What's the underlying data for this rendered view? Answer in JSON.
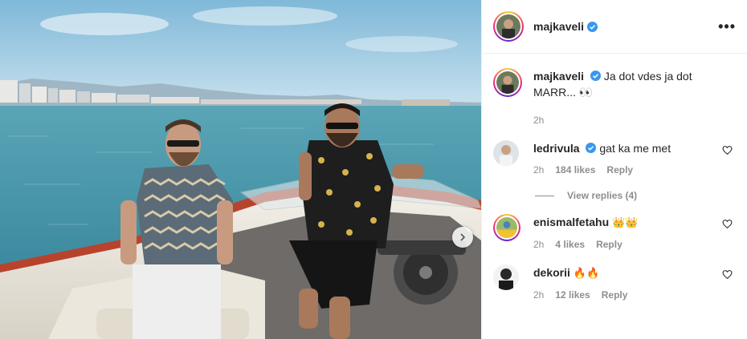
{
  "post": {
    "username": "majkaveli",
    "verified": true,
    "more_icon": "•••"
  },
  "caption": {
    "username": "majkaveli",
    "text": "Ja dot vdes ja dot MARR... 👀",
    "time": "2h"
  },
  "comments": [
    {
      "username": "ledrivula",
      "verified": true,
      "text": "gat ka me met",
      "time": "2h",
      "likes": "184 likes",
      "reply": "Reply",
      "view_replies": "View replies (4)"
    },
    {
      "username": "enismalfetahu",
      "verified": false,
      "text": "👑👑",
      "time": "2h",
      "likes": "4 likes",
      "reply": "Reply"
    },
    {
      "username": "dekorii",
      "verified": false,
      "text": "🔥🔥",
      "time": "2h",
      "likes": "12 likes",
      "reply": "Reply"
    }
  ],
  "colors": {
    "verified_blue": "#3897f0",
    "sea": "#3e93a8",
    "sky": "#a9d2e8"
  },
  "icons": {
    "verified": "verified-badge-icon",
    "heart": "heart-icon",
    "next": "chevron-right-icon"
  }
}
